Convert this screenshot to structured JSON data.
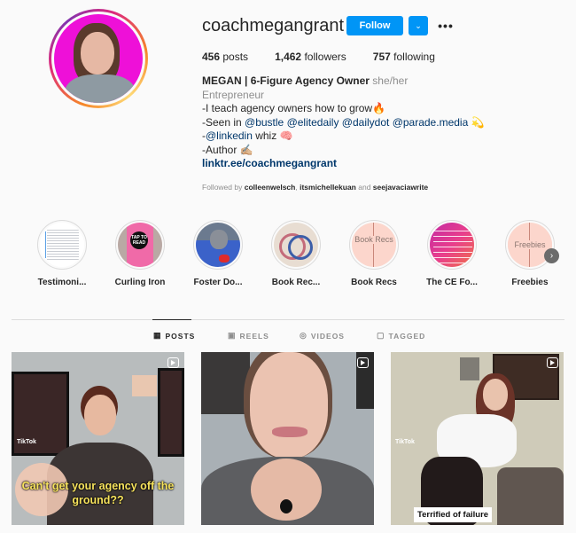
{
  "profile": {
    "username": "coachmegangrant",
    "follow_label": "Follow",
    "dropdown_icon": "chevron-down-icon",
    "more_icon": "more-horizontal-icon",
    "more_label": "•••",
    "stats": [
      {
        "count": "456",
        "label": "posts"
      },
      {
        "count": "1,462",
        "label": "followers"
      },
      {
        "count": "757",
        "label": "following"
      }
    ],
    "display_name": "MEGAN | 6-Figure Agency Owner",
    "pronouns": "she/her",
    "category": "Entrepreneur",
    "bio_lines": {
      "line1": "-I teach agency owners how to grow🔥",
      "line2_prefix": "-Seen in ",
      "line2_mentions": [
        "@bustle",
        "@elitedaily",
        "@dailydot",
        "@parade.media"
      ],
      "line2_suffix": " 💫",
      "line3_prefix": "-",
      "line3_mention": "@linkedin",
      "line3_suffix": " whiz 🧠",
      "line4": "-Author ✍🏼"
    },
    "link": "linktr.ee/coachmegangrant",
    "followed_by_prefix": "Followed by ",
    "followed_by_users": [
      "colleenwelsch",
      "itsmichellekuan",
      "seejavaciawrite"
    ],
    "followed_by_sep": ", ",
    "followed_by_and": " and "
  },
  "highlights": [
    {
      "label": "Testimoni...",
      "colors": [
        "#ffffff",
        "#e8eef5"
      ]
    },
    {
      "label": "Curling Iron",
      "colors": [
        "#f06aa8",
        "#b9a9a4"
      ]
    },
    {
      "label": "Foster Do...",
      "colors": [
        "#3b62c9",
        "#5b6f8f"
      ]
    },
    {
      "label": "Book Rec...",
      "colors": [
        "#e8ddd2",
        "#c46b7a"
      ]
    },
    {
      "label": "Book Recs",
      "colors": [
        "#fcd6cc",
        "#fcd6cc"
      ],
      "text": "Book Recs"
    },
    {
      "label": "The CE Fo...",
      "colors": [
        "#e83e8c",
        "#f0704a"
      ]
    },
    {
      "label": "Freebies",
      "colors": [
        "#fcd6cc",
        "#fcd6cc"
      ],
      "text": "Freebies"
    }
  ],
  "highlights_next_icon": "chevron-right-icon",
  "highlights_next_label": "›",
  "tabs": [
    {
      "label": "POSTS",
      "icon": "grid-icon",
      "glyph": "▦",
      "active": true
    },
    {
      "label": "REELS",
      "icon": "reels-icon",
      "glyph": "▣",
      "active": false
    },
    {
      "label": "VIDEOS",
      "icon": "video-icon",
      "glyph": "◎",
      "active": false
    },
    {
      "label": "TAGGED",
      "icon": "tagged-icon",
      "glyph": "▢",
      "active": false
    }
  ],
  "posts": [
    {
      "type": "reel",
      "caption": "Can't get your agency off the ground??",
      "watermark": "TikTok"
    },
    {
      "type": "reel",
      "caption": "",
      "watermark": ""
    },
    {
      "type": "reel",
      "caption": "Terrified of failure",
      "watermark": "TikTok"
    }
  ]
}
